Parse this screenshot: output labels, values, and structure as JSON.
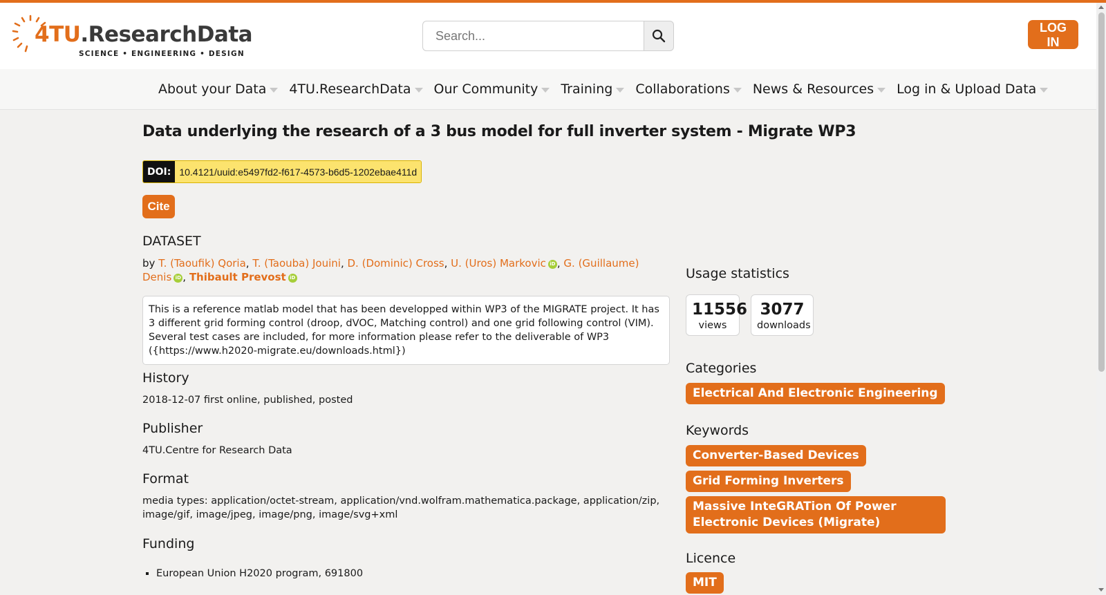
{
  "header": {
    "logo_prefix": "4TU",
    "logo_suffix": ".ResearchData",
    "logo_tagline": "SCIENCE • ENGINEERING • DESIGN",
    "search_placeholder": "Search...",
    "login_label": "LOG IN"
  },
  "nav": {
    "items": [
      {
        "label": "About your Data"
      },
      {
        "label": "4TU.ResearchData"
      },
      {
        "label": "Our Community"
      },
      {
        "label": "Training"
      },
      {
        "label": "Collaborations"
      },
      {
        "label": "News & Resources"
      },
      {
        "label": "Log in & Upload Data"
      }
    ]
  },
  "dataset": {
    "title": "Data underlying the research of a 3 bus model for full inverter system - Migrate WP3",
    "doi_label": "DOI:",
    "doi_value": "10.4121/uuid:e5497fd2-f617-4573-b6d5-1202ebae411d",
    "cite_label": "Cite",
    "kind": "DATASET",
    "by": "by",
    "authors": [
      {
        "name": "T. (Taoufik) Qoria",
        "orcid": false
      },
      {
        "name": "T. (Taouba) Jouini",
        "orcid": false
      },
      {
        "name": "D. (Dominic) Cross",
        "orcid": false
      },
      {
        "name": "U. (Uros) Markovic",
        "orcid": true
      },
      {
        "name": "G. (Guillaume) Denis",
        "orcid": true
      },
      {
        "name": "Thibault Prevost",
        "orcid": true
      }
    ],
    "orcid_badge": "iD",
    "description": "This is a reference matlab model that has been developped within WP3 of the MIGRATE project. It has 3 different grid forming control (droop, dVOC, Matching control) and one grid following control (VIM). Several test cases are included, for more information please refer to the deliverable of WP3 ({https://www.h2020-migrate.eu/downloads.html})",
    "history_heading": "History",
    "history_text": "2018-12-07 first online, published, posted",
    "publisher_heading": "Publisher",
    "publisher_text": "4TU.Centre for Research Data",
    "format_heading": "Format",
    "format_text": "media types: application/octet-stream, application/vnd.wolfram.mathematica.package, application/zip, image/gif, image/jpeg, image/png, image/svg+xml",
    "funding_heading": "Funding",
    "funding_items": [
      "European Union H2020 program, 691800"
    ]
  },
  "sidebar": {
    "usage_heading": "Usage statistics",
    "views_value": "11556",
    "views_label": "views",
    "downloads_value": "3077",
    "downloads_label": "downloads",
    "categories_heading": "Categories",
    "categories": [
      "Electrical And Electronic Engineering"
    ],
    "keywords_heading": "Keywords",
    "keywords": [
      "Converter-Based Devices",
      "Grid Forming Inverters",
      "Massive InteGRATion Of Power Electronic Devices (Migrate)"
    ],
    "licence_heading": "Licence",
    "licence_value": "MIT"
  },
  "colors": {
    "accent": "#e26e1b",
    "doi_background": "#fce36e",
    "orcid": "#a6ce39"
  }
}
